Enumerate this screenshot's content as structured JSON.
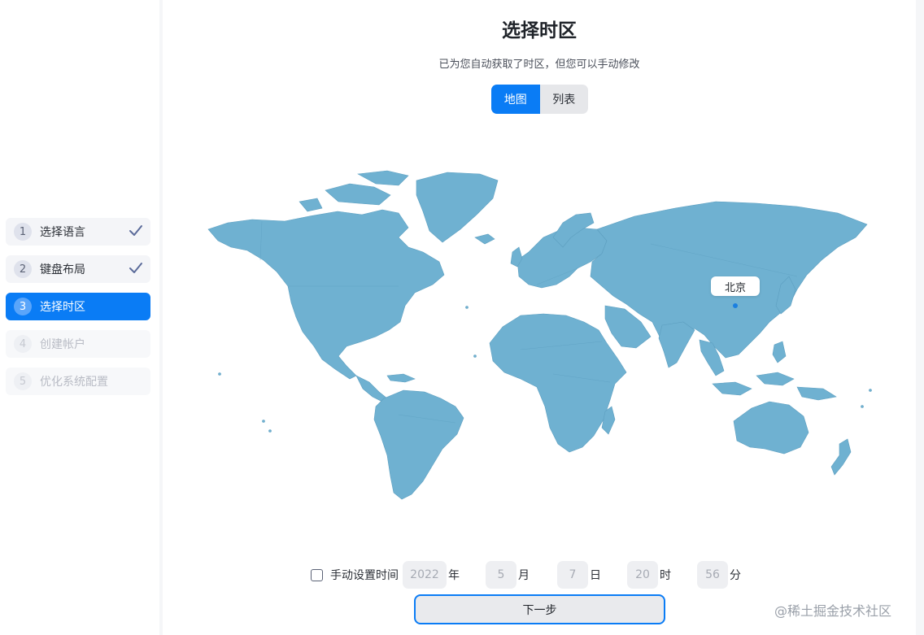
{
  "steps": [
    {
      "num": "1",
      "label": "选择语言",
      "state": "done"
    },
    {
      "num": "2",
      "label": "键盘布局",
      "state": "done"
    },
    {
      "num": "3",
      "label": "选择时区",
      "state": "active"
    },
    {
      "num": "4",
      "label": "创建帐户",
      "state": "pending"
    },
    {
      "num": "5",
      "label": "优化系统配置",
      "state": "pending"
    }
  ],
  "header": {
    "title": "选择时区",
    "subtitle": "已为您自动获取了时区，但您可以手动修改"
  },
  "view_toggle": {
    "map_label": "地图",
    "list_label": "列表",
    "selected": "map"
  },
  "map": {
    "selected_city": "北京"
  },
  "time": {
    "manual_label": "手动设置时间",
    "manual_checked": false,
    "year": "2022",
    "year_unit": "年",
    "month": "5",
    "month_unit": "月",
    "day": "7",
    "day_unit": "日",
    "hour": "20",
    "hour_unit": "时",
    "minute": "56",
    "minute_unit": "分"
  },
  "next_button": "下一步",
  "watermark": "@稀土掘金技术社区",
  "colors": {
    "accent": "#0a7cf5",
    "map_land": "#6fb1d1"
  }
}
